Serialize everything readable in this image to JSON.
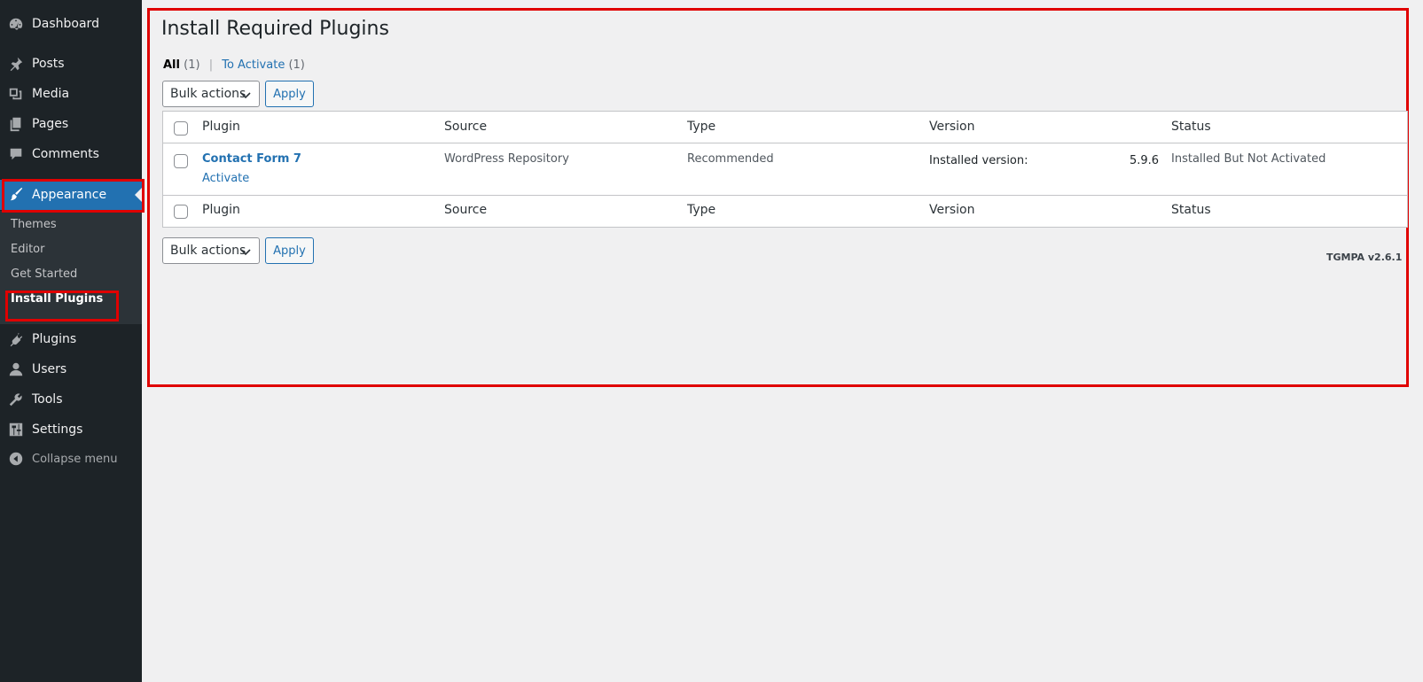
{
  "sidebar": {
    "items": [
      {
        "label": "Dashboard",
        "icon": "dashboard-icon"
      },
      {
        "label": "Posts",
        "icon": "pin-icon"
      },
      {
        "label": "Media",
        "icon": "media-icon"
      },
      {
        "label": "Pages",
        "icon": "pages-icon"
      },
      {
        "label": "Comments",
        "icon": "comment-icon"
      },
      {
        "label": "Appearance",
        "icon": "brush-icon"
      },
      {
        "label": "Plugins",
        "icon": "plug-icon"
      },
      {
        "label": "Users",
        "icon": "user-icon"
      },
      {
        "label": "Tools",
        "icon": "wrench-icon"
      },
      {
        "label": "Settings",
        "icon": "sliders-icon"
      },
      {
        "label": "Collapse menu",
        "icon": "collapse-icon"
      }
    ],
    "submenu": [
      {
        "label": "Themes"
      },
      {
        "label": "Editor"
      },
      {
        "label": "Get Started"
      },
      {
        "label": "Install Plugins"
      }
    ]
  },
  "page": {
    "title": "Install Required Plugins",
    "views": {
      "all_label": "All",
      "all_count": "(1)",
      "separator": "|",
      "to_activate_label": "To Activate",
      "to_activate_count": "(1)"
    },
    "bulk_actions_label": "Bulk actions",
    "apply_label": "Apply",
    "table": {
      "headers": [
        "Plugin",
        "Source",
        "Type",
        "Version",
        "Status"
      ],
      "rows": [
        {
          "plugin": "Contact Form 7",
          "action": "Activate",
          "source": "WordPress Repository",
          "type": "Recommended",
          "version_label": "Installed version:",
          "version_value": "5.9.6",
          "status": "Installed But Not Activated"
        }
      ]
    },
    "footer_version": "TGMPA v2.6.1"
  },
  "colors": {
    "sidebar_bg": "#1d2327",
    "active_bg": "#2271b1",
    "link": "#2271b1",
    "highlight": "#e00000",
    "page_bg": "#f0f0f1"
  }
}
